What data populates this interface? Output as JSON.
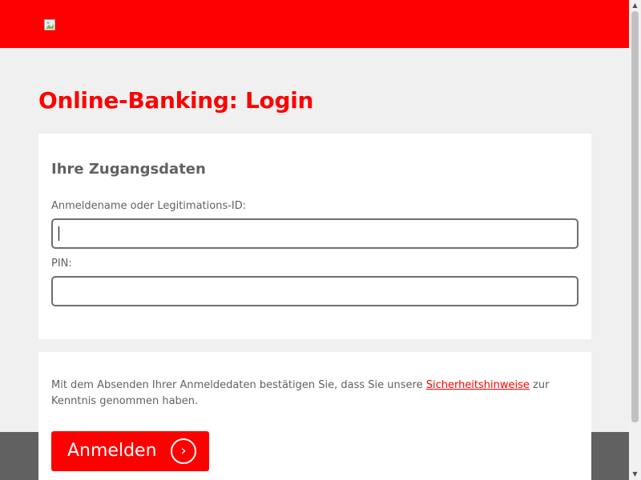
{
  "header": {
    "logo_icon": "broken-image-icon",
    "background_color": "#ff0000"
  },
  "page": {
    "title": "Online-Banking: Login"
  },
  "credentials": {
    "heading": "Ihre Zugangsdaten",
    "username_label": "Anmeldename oder Legitimations-ID:",
    "username_value": "",
    "pin_label": "PIN:",
    "pin_value": ""
  },
  "confirmation": {
    "text_before": "Mit dem Absenden Ihrer Anmeldedaten bestätigen Sie, dass Sie unsere ",
    "link_text": "Sicherheitshinweise",
    "text_after": " zur Kenntnis genommen haben.",
    "submit_label": "Anmelden",
    "submit_icon": "chevron-right-icon",
    "submit_icon_glyph": "›"
  },
  "colors": {
    "brand": "#ff0000",
    "text": "#616161",
    "background": "#f0f0f0",
    "footer": "#616161"
  }
}
